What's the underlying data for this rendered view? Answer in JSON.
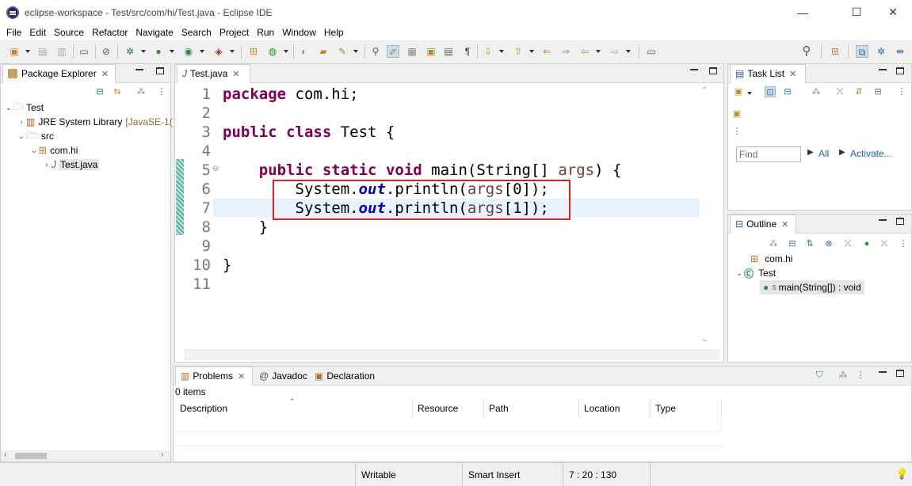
{
  "window": {
    "title": "eclipse-workspace - Test/src/com/hi/Test.java - Eclipse IDE",
    "minimize_glyph": "—",
    "maximize_glyph": "☐",
    "close_glyph": "✕"
  },
  "menu": [
    "File",
    "Edit",
    "Source",
    "Refactor",
    "Navigate",
    "Search",
    "Project",
    "Run",
    "Window",
    "Help"
  ],
  "package_explorer": {
    "tab_label": "Package Explorer",
    "tree": {
      "project": "Test",
      "jre_label": "JRE System Library",
      "jre_version": "[JavaSE-1(",
      "src": "src",
      "package": "com.hi",
      "file": "Test.java"
    }
  },
  "editor": {
    "tab_label": "Test.java",
    "lines": [
      {
        "n": "1"
      },
      {
        "n": "2"
      },
      {
        "n": "3"
      },
      {
        "n": "4"
      },
      {
        "n": "5"
      },
      {
        "n": "6"
      },
      {
        "n": "7"
      },
      {
        "n": "8"
      },
      {
        "n": "9"
      },
      {
        "n": "10"
      },
      {
        "n": "11"
      }
    ],
    "code": {
      "l1_kw": "package",
      "l1_rest": " com.hi;",
      "l3_kw1": "public",
      "l3_kw2": "class",
      "l3_rest": " Test {",
      "l5_kw1": "public",
      "l5_kw2": "static",
      "l5_kw3": "void",
      "l5_rest1": " main(String[] ",
      "l5_var": "args",
      "l5_rest2": ") {",
      "l6_a": "System.",
      "l6_fld": "out",
      "l6_b": ".println(",
      "l6_var": "args",
      "l6_c": "[0]);",
      "l7_a": "System.",
      "l7_fld": "out",
      "l7_b": ".println(",
      "l7_var": "args",
      "l7_c": "[1]);",
      "l8": "}",
      "l10": "}"
    },
    "fold_marker": "⊖",
    "highlight_color": "#e0201f",
    "current_line_color": "#e8f2fe"
  },
  "task_list": {
    "tab_label": "Task List",
    "find_placeholder": "Find",
    "all_label": "All",
    "activate_label": "Activate..."
  },
  "outline": {
    "tab_label": "Outline",
    "items": {
      "package": "com.hi",
      "class": "Test",
      "method": "main(String[]) : void"
    }
  },
  "bottom": {
    "tabs": {
      "problems": "Problems",
      "javadoc": "Javadoc",
      "declaration": "Declaration"
    },
    "count": "0 items",
    "columns": [
      "Description",
      "Resource",
      "Path",
      "Location",
      "Type"
    ]
  },
  "status": {
    "writable": "Writable",
    "insert_mode": "Smart Insert",
    "position": "7 : 20 : 130"
  }
}
